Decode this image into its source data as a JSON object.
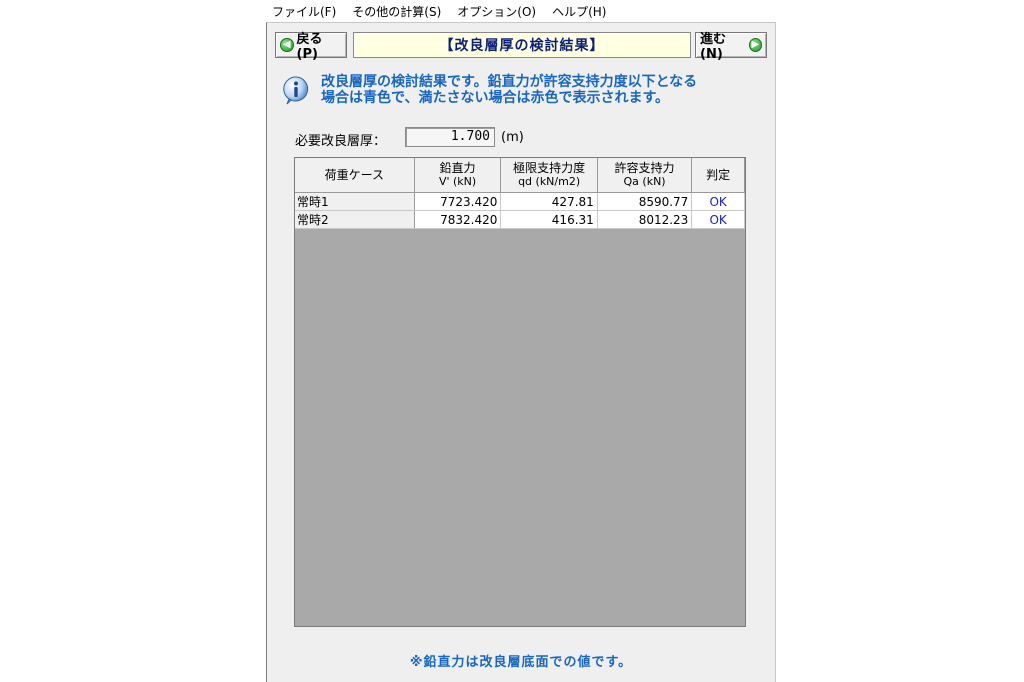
{
  "menu": {
    "file": "ファイル(F)",
    "calc": "その他の計算(S)",
    "options": "オプション(O)",
    "help": "ヘルプ(H)"
  },
  "toolbar": {
    "back_label": "戻る(P)",
    "title": "【改良層厚の検討結果】",
    "next_label": "進む(N)"
  },
  "info": {
    "line1": "改良層厚の検討結果です。鉛直力が許容支持力度以下となる",
    "line2": "場合は青色で、満たさない場合は赤色で表示されます。"
  },
  "required": {
    "label": "必要改良層厚：",
    "value": "1.700",
    "unit": "(m)"
  },
  "table": {
    "headers": [
      {
        "main": "荷重ケース",
        "sub": ""
      },
      {
        "main": "鉛直力",
        "sub": "V' (kN)"
      },
      {
        "main": "極限支持力度",
        "sub": "qd (kN/m2)"
      },
      {
        "main": "許容支持力",
        "sub": "Qa (kN)"
      },
      {
        "main": "判定",
        "sub": ""
      }
    ],
    "rows": [
      {
        "case": "常時1",
        "v": "7723.420",
        "qd": "427.81",
        "qa": "8590.77",
        "judge": "OK"
      },
      {
        "case": "常時2",
        "v": "7832.420",
        "qd": "416.31",
        "qa": "8012.23",
        "judge": "OK"
      }
    ]
  },
  "footnote": "※鉛直力は改良層底面での値です。",
  "colors": {
    "ok": "#1d21c8",
    "info_text": "#1766c4",
    "title_text": "#0b1f78",
    "grid_bg": "#a9a9a9"
  }
}
